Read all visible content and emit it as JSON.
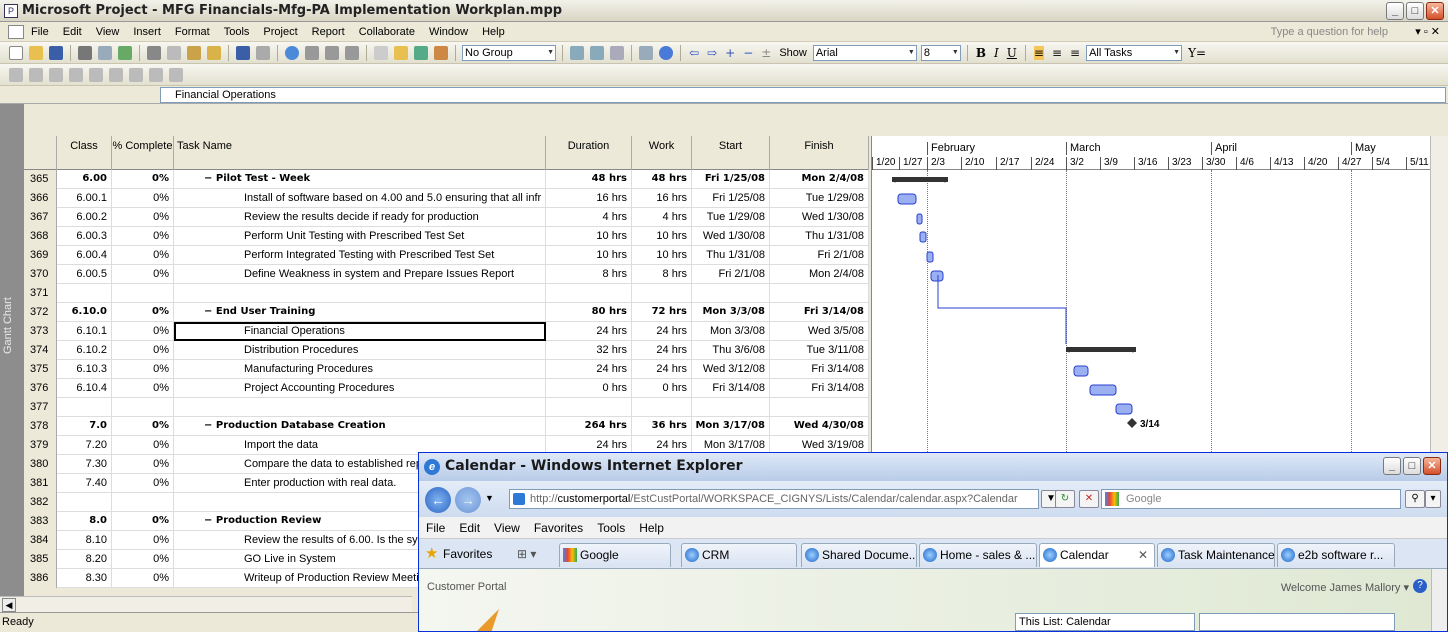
{
  "project": {
    "title": "Microsoft Project - MFG Financials-Mfg-PA Implementation Workplan.mpp",
    "menu": [
      "File",
      "Edit",
      "View",
      "Insert",
      "Format",
      "Tools",
      "Project",
      "Report",
      "Collaborate",
      "Window",
      "Help"
    ],
    "help_placeholder": "Type a question for help",
    "toolbar": {
      "group": "No Group",
      "show": "Show",
      "font": "Arial",
      "size": "8",
      "filter": "All Tasks"
    },
    "entry_value": "Financial Operations",
    "side_label": "Gantt Chart",
    "columns": {
      "class": "Class",
      "pct": "% Complete",
      "name": "Task Name",
      "duration": "Duration",
      "work": "Work",
      "start": "Start",
      "finish": "Finish"
    },
    "rows": [
      {
        "id": "365",
        "cls": "6.00",
        "pct": "0%",
        "name": "−  Pilot Test - Week",
        "dur": "48 hrs",
        "work": "48 hrs",
        "start": "Fri 1/25/08",
        "finish": "Mon 2/4/08",
        "summary": true
      },
      {
        "id": "366",
        "cls": "6.00.1",
        "pct": "0%",
        "name": "Install of software based on 4.00 and 5.0 ensuring that all infr",
        "dur": "16 hrs",
        "work": "16 hrs",
        "start": "Fri 1/25/08",
        "finish": "Tue 1/29/08"
      },
      {
        "id": "367",
        "cls": "6.00.2",
        "pct": "0%",
        "name": "Review the results decide if ready for production",
        "dur": "4 hrs",
        "work": "4 hrs",
        "start": "Tue 1/29/08",
        "finish": "Wed 1/30/08"
      },
      {
        "id": "368",
        "cls": "6.00.3",
        "pct": "0%",
        "name": "Perform Unit Testing with Prescribed Test Set",
        "dur": "10 hrs",
        "work": "10 hrs",
        "start": "Wed 1/30/08",
        "finish": "Thu 1/31/08"
      },
      {
        "id": "369",
        "cls": "6.00.4",
        "pct": "0%",
        "name": "Perform Integrated Testing with Prescribed Test Set",
        "dur": "10 hrs",
        "work": "10 hrs",
        "start": "Thu 1/31/08",
        "finish": "Fri 2/1/08"
      },
      {
        "id": "370",
        "cls": "6.00.5",
        "pct": "0%",
        "name": "Define Weakness in system and Prepare Issues Report",
        "dur": "8 hrs",
        "work": "8 hrs",
        "start": "Fri 2/1/08",
        "finish": "Mon 2/4/08"
      },
      {
        "id": "371",
        "cls": "",
        "pct": "",
        "name": "",
        "dur": "",
        "work": "",
        "start": "",
        "finish": ""
      },
      {
        "id": "372",
        "cls": "6.10.0",
        "pct": "0%",
        "name": "−  End User Training",
        "dur": "80 hrs",
        "work": "72 hrs",
        "start": "Mon 3/3/08",
        "finish": "Fri 3/14/08",
        "summary": true
      },
      {
        "id": "373",
        "cls": "6.10.1",
        "pct": "0%",
        "name": "Financial Operations",
        "dur": "24 hrs",
        "work": "24 hrs",
        "start": "Mon 3/3/08",
        "finish": "Wed 3/5/08",
        "selected": true
      },
      {
        "id": "374",
        "cls": "6.10.2",
        "pct": "0%",
        "name": "Distribution Procedures",
        "dur": "32 hrs",
        "work": "24 hrs",
        "start": "Thu 3/6/08",
        "finish": "Tue 3/11/08"
      },
      {
        "id": "375",
        "cls": "6.10.3",
        "pct": "0%",
        "name": "Manufacturing Procedures",
        "dur": "24 hrs",
        "work": "24 hrs",
        "start": "Wed 3/12/08",
        "finish": "Fri 3/14/08"
      },
      {
        "id": "376",
        "cls": "6.10.4",
        "pct": "0%",
        "name": "Project Accounting Procedures",
        "dur": "0 hrs",
        "work": "0 hrs",
        "start": "Fri 3/14/08",
        "finish": "Fri 3/14/08"
      },
      {
        "id": "377",
        "cls": "",
        "pct": "",
        "name": "",
        "dur": "",
        "work": "",
        "start": "",
        "finish": ""
      },
      {
        "id": "378",
        "cls": "7.0",
        "pct": "0%",
        "name": "−  Production Database Creation",
        "dur": "264 hrs",
        "work": "36 hrs",
        "start": "Mon 3/17/08",
        "finish": "Wed 4/30/08",
        "summary": true
      },
      {
        "id": "379",
        "cls": "7.20",
        "pct": "0%",
        "name": "Import the data",
        "dur": "24 hrs",
        "work": "24 hrs",
        "start": "Mon 3/17/08",
        "finish": "Wed 3/19/08"
      },
      {
        "id": "380",
        "cls": "7.30",
        "pct": "0%",
        "name": "Compare the data to established rep",
        "dur": "",
        "work": "",
        "start": "",
        "finish": ""
      },
      {
        "id": "381",
        "cls": "7.40",
        "pct": "0%",
        "name": "Enter production with real data.",
        "dur": "",
        "work": "",
        "start": "",
        "finish": ""
      },
      {
        "id": "382",
        "cls": "",
        "pct": "",
        "name": "",
        "dur": "",
        "work": "",
        "start": "",
        "finish": ""
      },
      {
        "id": "383",
        "cls": "8.0",
        "pct": "0%",
        "name": "−  Production Review",
        "dur": "",
        "work": "",
        "start": "",
        "finish": "",
        "summary": true
      },
      {
        "id": "384",
        "cls": "8.10",
        "pct": "0%",
        "name": "Review the results of 6.00. Is the sy",
        "dur": "",
        "work": "",
        "start": "",
        "finish": ""
      },
      {
        "id": "385",
        "cls": "8.20",
        "pct": "0%",
        "name": "GO Live in System",
        "dur": "",
        "work": "",
        "start": "",
        "finish": ""
      },
      {
        "id": "386",
        "cls": "8.30",
        "pct": "0%",
        "name": "Writeup of Production Review Meeti",
        "dur": "",
        "work": "",
        "start": "",
        "finish": ""
      }
    ],
    "gantt": {
      "months": [
        "February",
        "March",
        "April",
        "May"
      ],
      "weeks": [
        "1/20",
        "1/27",
        "2/3",
        "2/10",
        "2/17",
        "2/24",
        "3/2",
        "3/9",
        "3/16",
        "3/23",
        "3/30",
        "4/6",
        "4/13",
        "4/20",
        "4/27",
        "5/4",
        "5/11"
      ],
      "milestone_label": "3/14"
    },
    "status": "Ready"
  },
  "ie": {
    "title": "Calendar - Windows Internet Explorer",
    "url_prefix": "http://",
    "url_host": "customerportal",
    "url_rest": "/EstCustPortal/WORKSPACE_CIGNYS/Lists/Calendar/calendar.aspx?Calendar",
    "search_placeholder": "Google",
    "menu": [
      "File",
      "Edit",
      "View",
      "Favorites",
      "Tools",
      "Help"
    ],
    "favorites": "Favorites",
    "tabs": [
      "Google",
      "CRM",
      "Shared Docume...",
      "Home - sales & ...",
      "Calendar",
      "Task Maintenance",
      "e2b software r..."
    ],
    "portal": "Customer Portal",
    "welcome": "Welcome James Mallory ▾",
    "list_scope": "This List: Calendar"
  }
}
